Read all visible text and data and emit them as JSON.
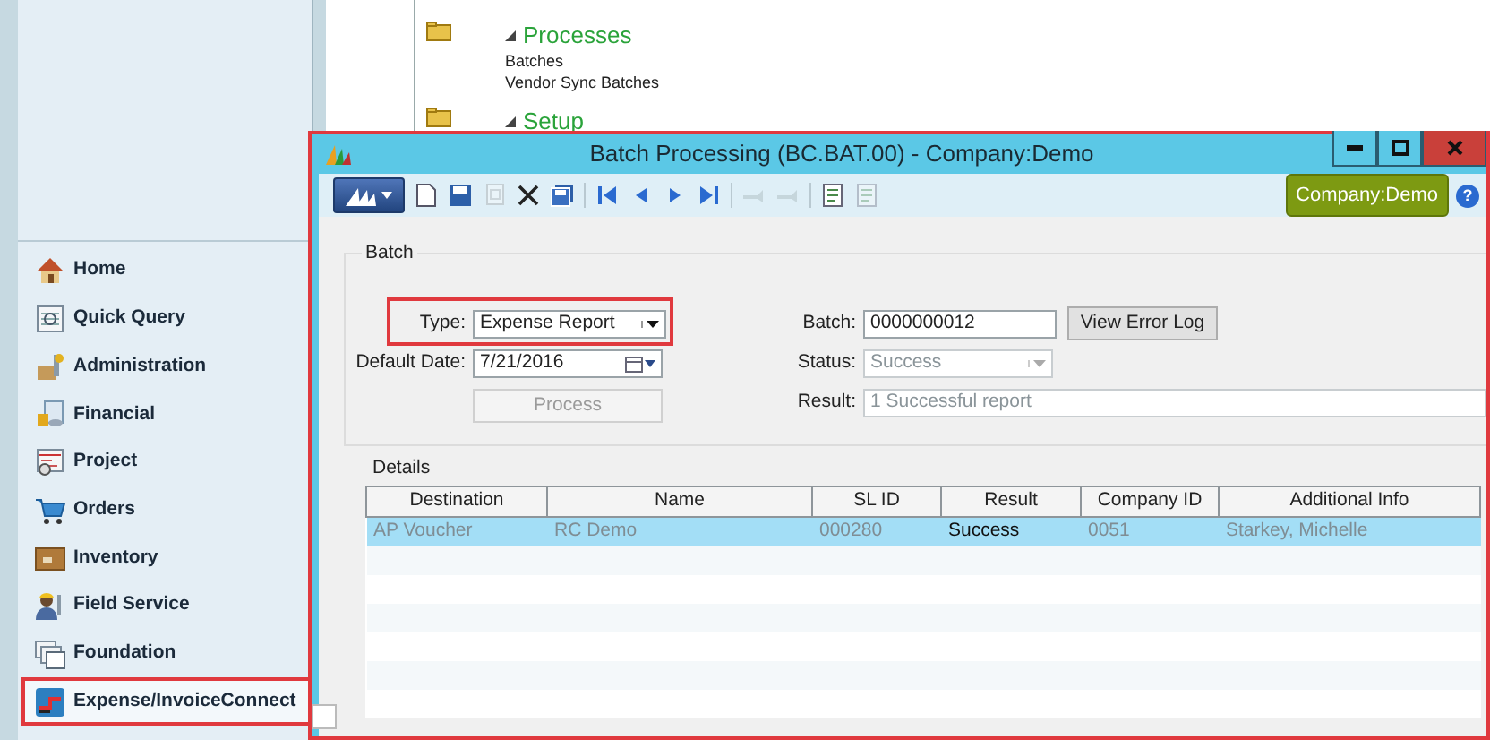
{
  "sidebar": {
    "items": [
      {
        "label": "Home",
        "kind": "house",
        "selected": false,
        "annotated": false
      },
      {
        "label": "Quick Query",
        "kind": "query",
        "selected": false,
        "annotated": false
      },
      {
        "label": "Administration",
        "kind": "tools",
        "selected": false,
        "annotated": false
      },
      {
        "label": "Financial",
        "kind": "coins",
        "selected": false,
        "annotated": false
      },
      {
        "label": "Project",
        "kind": "schedule",
        "selected": false,
        "annotated": false
      },
      {
        "label": "Orders",
        "kind": "cart",
        "selected": false,
        "annotated": false
      },
      {
        "label": "Inventory",
        "kind": "box",
        "selected": false,
        "annotated": false
      },
      {
        "label": "Field Service",
        "kind": "worker",
        "selected": false,
        "annotated": false
      },
      {
        "label": "Foundation",
        "kind": "windows",
        "selected": false,
        "annotated": false
      },
      {
        "label": "Expense/InvoiceConnect",
        "kind": "connect",
        "selected": true,
        "annotated": true
      }
    ]
  },
  "tree": [
    {
      "label": "Processes",
      "expanded": true,
      "children": [
        {
          "label": "Batches"
        },
        {
          "label": "Vendor Sync Batches"
        }
      ]
    },
    {
      "label": "Setup",
      "expanded": true
    }
  ],
  "dialog": {
    "title": "Batch Processing (BC.BAT.00) - Company:Demo",
    "annotated": true,
    "toolbar_groups": [
      [
        {
          "kind": "new",
          "disabled": false
        },
        {
          "kind": "save",
          "disabled": false
        },
        {
          "kind": "copy",
          "disabled": true
        },
        {
          "kind": "delete",
          "disabled": false
        },
        {
          "kind": "save-all",
          "disabled": false
        }
      ],
      [
        {
          "kind": "first",
          "disabled": false
        },
        {
          "kind": "prev",
          "disabled": false
        },
        {
          "kind": "next",
          "disabled": false
        },
        {
          "kind": "last",
          "disabled": false
        }
      ],
      [
        {
          "kind": "tool",
          "disabled": true
        },
        {
          "kind": "tool",
          "disabled": true
        }
      ],
      [
        {
          "kind": "report",
          "disabled": false
        },
        {
          "kind": "report",
          "disabled": true
        }
      ]
    ],
    "company_badge": "Company:Demo",
    "help_label": "?",
    "batch_group": {
      "title": "Batch",
      "type": {
        "label": "Type:",
        "value": "Expense Report",
        "annotated": true
      },
      "default_date": {
        "label": "Default Date:",
        "value": "7/21/2016"
      },
      "process_button": {
        "label": "Process",
        "disabled": true
      },
      "batch": {
        "label": "Batch:",
        "value": "0000000012"
      },
      "view_error_log_button": {
        "label": "View Error Log",
        "disabled": false
      },
      "status": {
        "label": "Status:",
        "value": "Success",
        "disabled": true
      },
      "result": {
        "label": "Result:",
        "value": "1 Successful report",
        "disabled": true
      }
    },
    "details": {
      "title": "Details",
      "columns": [
        {
          "label": "Destination",
          "kind": "text"
        },
        {
          "label": "Name",
          "kind": "text"
        },
        {
          "label": "SL ID",
          "kind": "text"
        },
        {
          "label": "Result",
          "kind": "status"
        },
        {
          "label": "Company ID",
          "kind": "text"
        },
        {
          "label": "Additional Info",
          "kind": "text"
        }
      ],
      "rows": [
        {
          "selected": true,
          "cells": [
            "AP Voucher",
            "RC Demo",
            "000280",
            "Success",
            "0051",
            "Starkey, Michelle"
          ]
        }
      ]
    }
  }
}
